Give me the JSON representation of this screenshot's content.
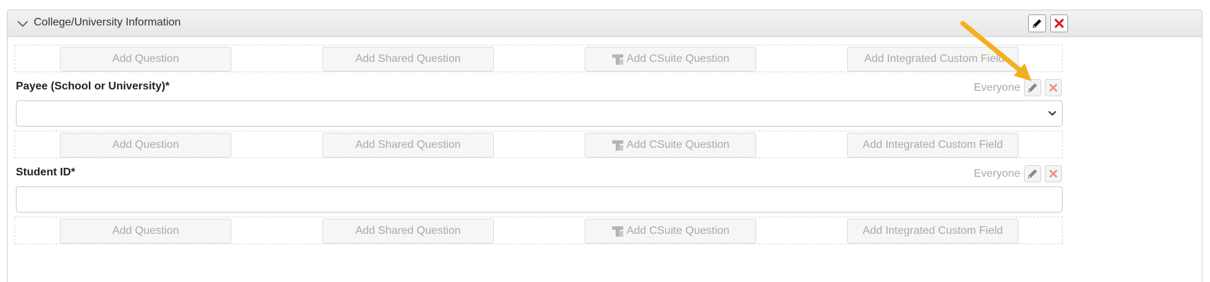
{
  "section": {
    "title": "College/University Information",
    "collapse_icon": "chevron-down-icon",
    "edit_icon": "pencil-icon",
    "delete_icon": "close-icon"
  },
  "add_buttons": {
    "add_question": "Add Question",
    "add_shared_question": "Add Shared Question",
    "add_csuite_question": "Add CSuite Question",
    "add_integrated_custom_field": "Add Integrated Custom Field",
    "add_integrated_custom_field_partial": "Add Integrated Custom Field"
  },
  "fields": [
    {
      "label": "Payee (School or University)*",
      "audience": "Everyone",
      "type": "select",
      "value": ""
    },
    {
      "label": "Student ID*",
      "audience": "Everyone",
      "type": "text",
      "value": ""
    }
  ],
  "colors": {
    "annotation_arrow": "#f2b01e",
    "delete_red": "#d9141b",
    "delete_red_muted": "#f08a8a"
  }
}
